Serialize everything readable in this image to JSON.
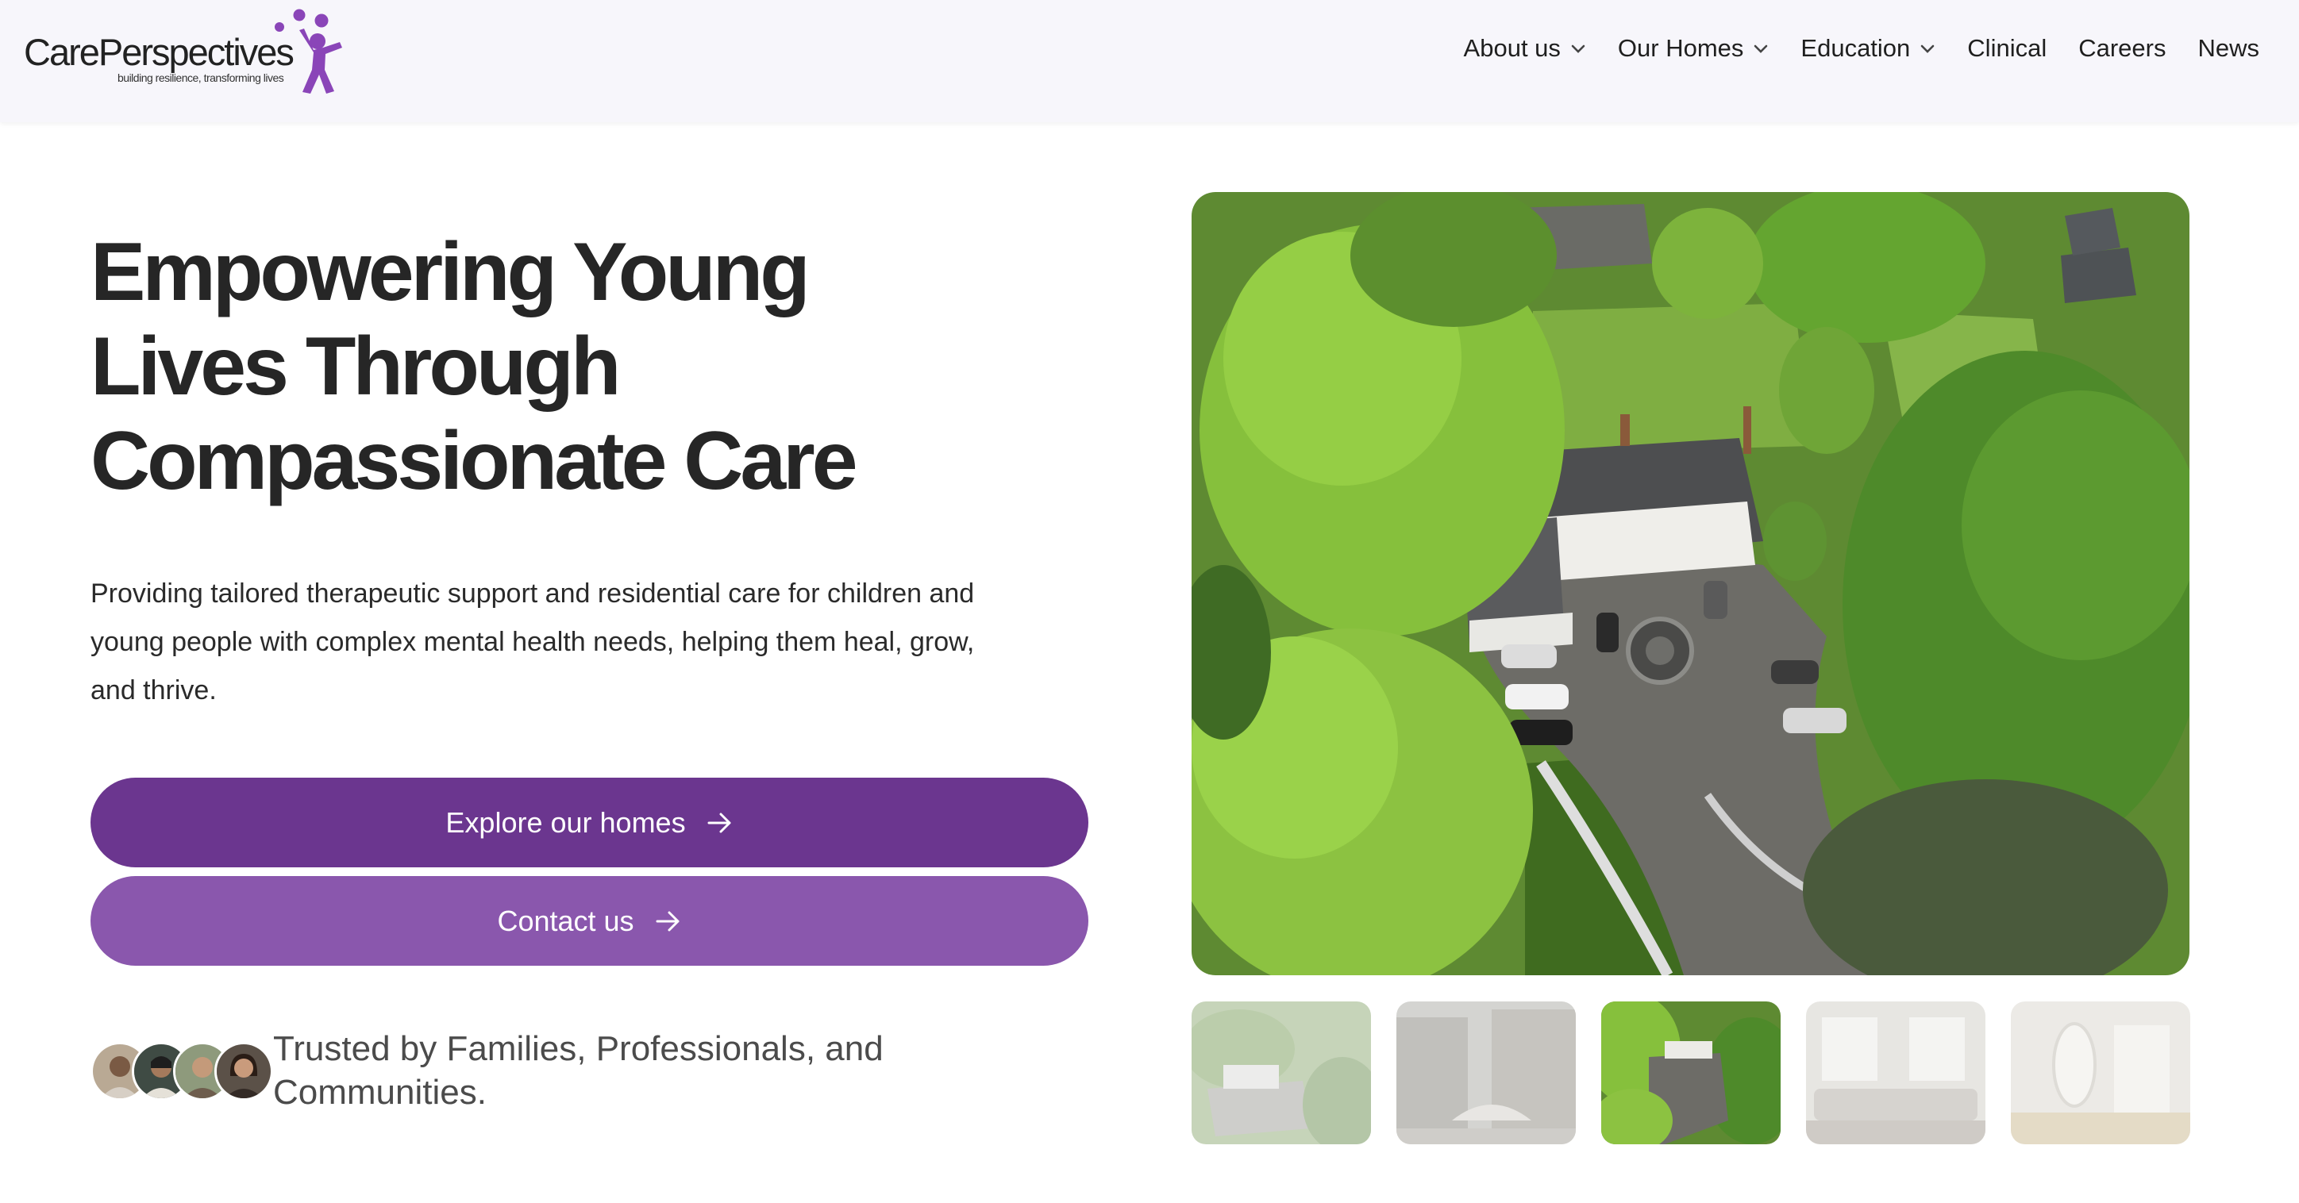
{
  "brand": {
    "name": "CarePerspectives",
    "tagline": "building resilience, transforming lives",
    "accent": "#6b368f",
    "accent_light": "#8a57ad",
    "logo_figure_color": "#8a45b8"
  },
  "nav": {
    "items": [
      {
        "label": "About us",
        "dropdown": true
      },
      {
        "label": "Our Homes",
        "dropdown": true
      },
      {
        "label": "Education",
        "dropdown": true
      },
      {
        "label": "Clinical",
        "dropdown": false
      },
      {
        "label": "Careers",
        "dropdown": false
      },
      {
        "label": "News",
        "dropdown": false
      }
    ]
  },
  "hero": {
    "title_lines": [
      "Empowering Young",
      "Lives Through",
      "Compassionate Care"
    ],
    "description_lines": [
      "Providing tailored therapeutic support and residential care for children and",
      "young people with complex mental health needs, helping them heal, grow,",
      "and thrive."
    ],
    "primary_button": "Explore our homes",
    "secondary_button": "Contact us"
  },
  "trust": {
    "lines": [
      "Trusted by Families, Professionals, and",
      "Communities."
    ],
    "avatar_count": 4
  },
  "gallery": {
    "main_image": "aerial-view-of-house-and-gardens",
    "thumbnails": [
      {
        "name": "aerial-garden-thumbnail",
        "active": false
      },
      {
        "name": "building-courtyard-thumbnail",
        "active": false
      },
      {
        "name": "aerial-driveway-thumbnail",
        "active": true
      },
      {
        "name": "living-room-thumbnail",
        "active": false
      },
      {
        "name": "hallway-mirror-thumbnail",
        "active": false
      }
    ]
  }
}
